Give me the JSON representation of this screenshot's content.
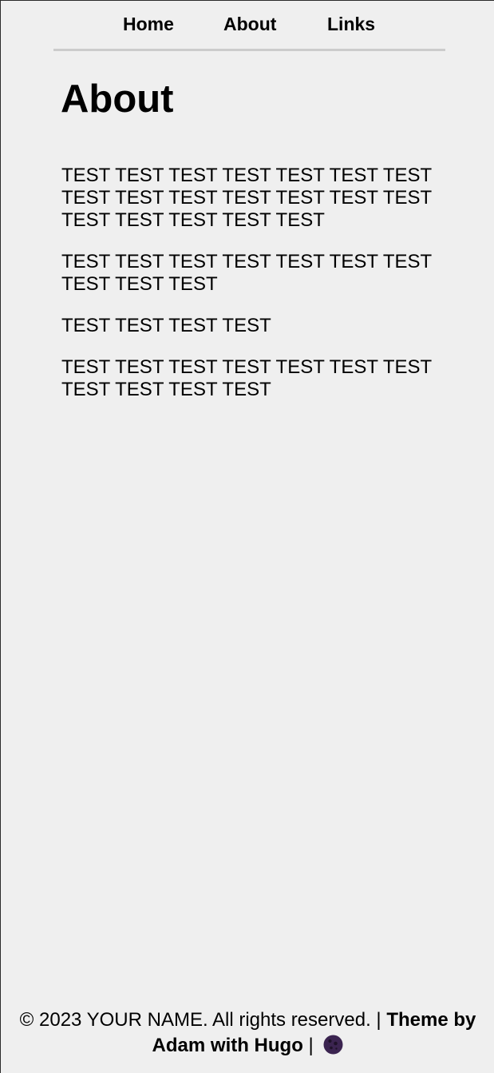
{
  "nav": {
    "home": "Home",
    "about": "About",
    "links": "Links"
  },
  "page_title": "About",
  "paragraphs": [
    "TEST TEST TEST TEST TEST TEST TEST TEST TEST TEST TEST TEST TEST TEST TEST TEST TEST TEST TEST",
    "TEST TEST TEST TEST TEST TEST TEST TEST TEST TEST",
    "TEST TEST TEST TEST",
    "TEST TEST TEST TEST TEST TEST TEST TEST TEST TEST TEST"
  ],
  "footer": {
    "copyright": "© 2023 YOUR NAME. All rights reserved. |",
    "theme_credit": "Theme by Adam with Hugo",
    "separator": "|",
    "theme_toggle_icon": "moon-icon"
  },
  "colors": {
    "background": "#efefef",
    "divider": "#cccccc",
    "moon": "#3b2450"
  }
}
